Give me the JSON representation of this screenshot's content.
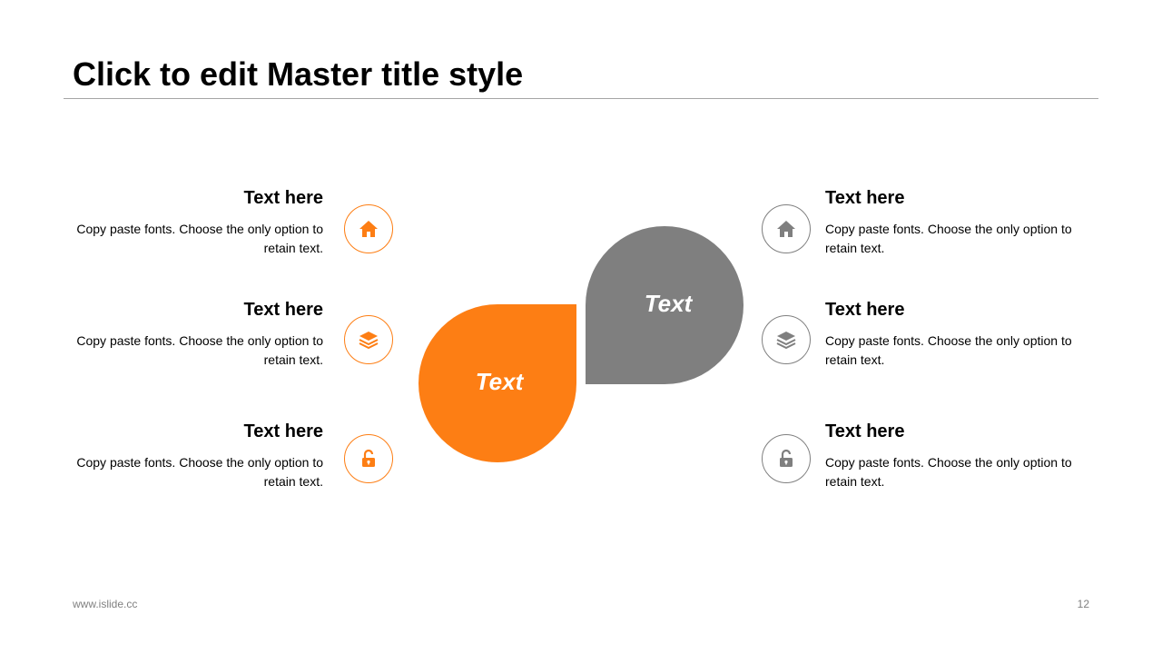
{
  "slide": {
    "title": "Click to edit Master title style"
  },
  "colors": {
    "accent": "#fd7e14",
    "neutral": "#7f7f7f",
    "title_rule": "#a6a6a6"
  },
  "center": {
    "orange_label": "Text",
    "gray_label": "Text"
  },
  "left_items": [
    {
      "title": "Text here",
      "body": "Copy paste fonts. Choose the only option to retain text.",
      "icon": "home-icon"
    },
    {
      "title": "Text here",
      "body": "Copy paste fonts. Choose the only option to retain text.",
      "icon": "layers-icon"
    },
    {
      "title": "Text here",
      "body": "Copy paste fonts. Choose the only option to retain text.",
      "icon": "unlock-icon"
    }
  ],
  "right_items": [
    {
      "title": "Text here",
      "body": "Copy paste fonts. Choose the only option to retain text.",
      "icon": "home-icon"
    },
    {
      "title": "Text here",
      "body": "Copy paste fonts. Choose the only option to retain text.",
      "icon": "layers-icon"
    },
    {
      "title": "Text here",
      "body": "Copy paste fonts. Choose the only option to retain text.",
      "icon": "unlock-icon"
    }
  ],
  "footer": {
    "url": "www.islide.cc",
    "page_number": "12"
  }
}
